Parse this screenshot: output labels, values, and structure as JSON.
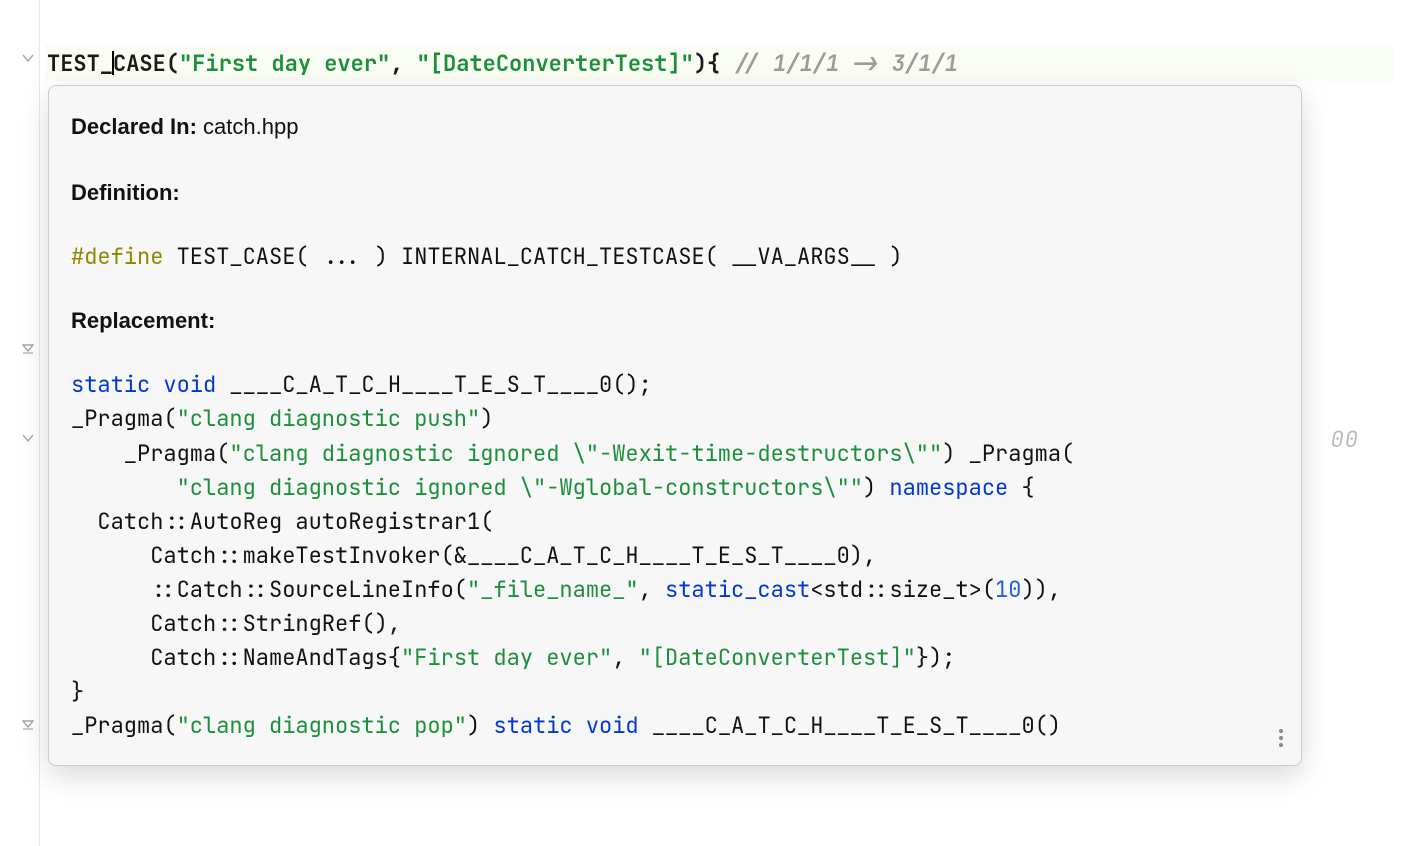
{
  "code_line": {
    "fn_pre": "TEST_",
    "fn_post": "CASE",
    "paren_open": "(",
    "str1": "\"First day ever\"",
    "comma": ", ",
    "str2": "\"[DateConverterTest]\"",
    "paren_close": ")",
    "brace_open": "{ ",
    "comment": "// 1/1/1 -> 3/1/1"
  },
  "gutter_hint": "00",
  "tooltip": {
    "declared_in_label": "Declared In:",
    "declared_in_value": " catch.hpp",
    "definition_label": "Definition:",
    "define_kw": "#define",
    "define_rest": " TEST_CASE( ... ) INTERNAL_CATCH_TESTCASE( __VA_ARGS__ )",
    "replacement_label": "Replacement:",
    "r1_kw1": "static",
    "r1_sp1": " ",
    "r1_kw2": "void",
    "r1_rest": " ____C_A_T_C_H____T_E_S_T____0();",
    "r2_pre": "_Pragma(",
    "r2_str": "\"clang diagnostic push\"",
    "r2_post": ")",
    "r3_pre": "    _Pragma(",
    "r3_str": "\"clang diagnostic ignored \\\"-Wexit-time-destructors\\\"\"",
    "r3_post": ") _Pragma(",
    "r4_pre": "        ",
    "r4_str": "\"clang diagnostic ignored \\\"-Wglobal-constructors\\\"\"",
    "r4_post": ") ",
    "r4_kw": "namespace",
    "r4_brace": " {",
    "r5": "  Catch::AutoReg autoRegistrar1(",
    "r6": "      Catch::makeTestInvoker(&____C_A_T_C_H____T_E_S_T____0),",
    "r7_pre": "      ::Catch::SourceLineInfo(",
    "r7_str": "\"_file_name_\"",
    "r7_mid": ", ",
    "r7_kw": "static_cast",
    "r7_after": "<std::size_t>(",
    "r7_num": "10",
    "r7_end": ")),",
    "r8": "      Catch::StringRef(),",
    "r9_pre": "      Catch::NameAndTags{",
    "r9_str1": "\"First day ever\"",
    "r9_mid": ", ",
    "r9_str2": "\"[DateConverterTest]\"",
    "r9_end": "});",
    "r10": "}",
    "r11_pre": "_Pragma(",
    "r11_str": "\"clang diagnostic pop\"",
    "r11_mid": ") ",
    "r11_kw1": "static",
    "r11_sp": " ",
    "r11_kw2": "void",
    "r11_rest": " ____C_A_T_C_H____T_E_S_T____0()"
  }
}
